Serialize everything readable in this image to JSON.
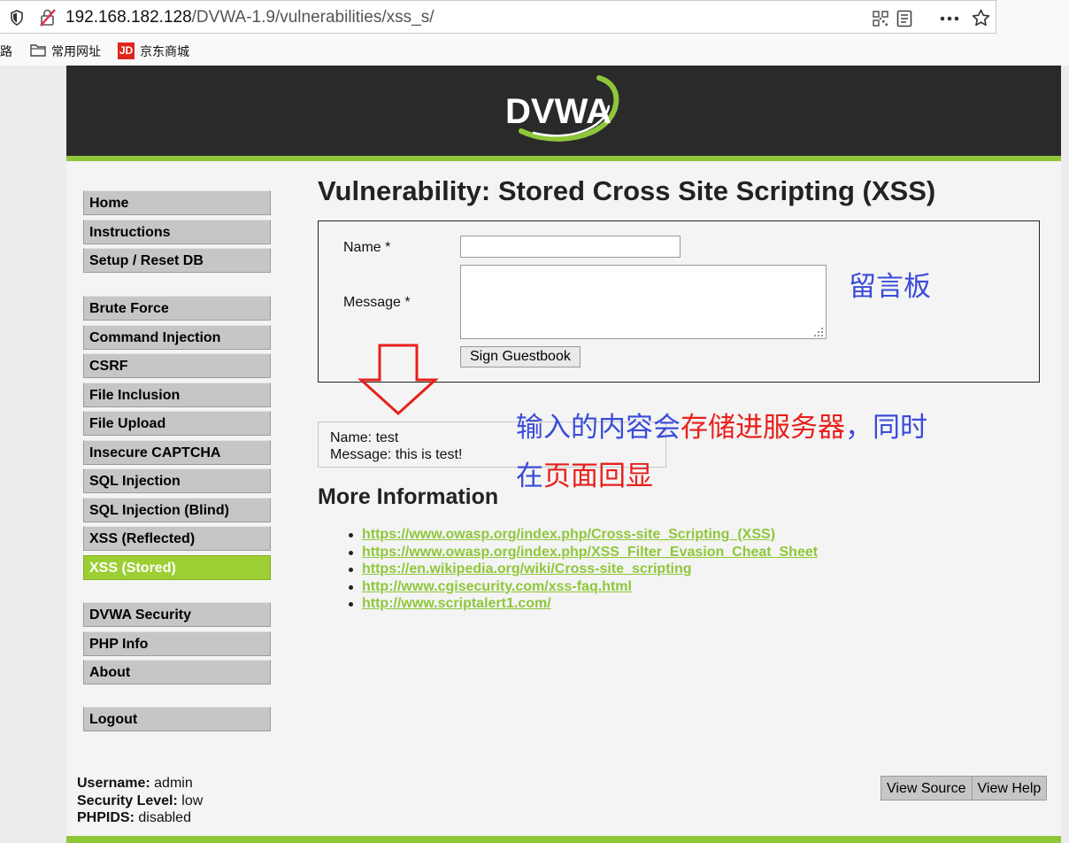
{
  "browser": {
    "url_host": "192.168.182.128",
    "url_path": "/DVWA-1.9/vulnerabilities/xss_s/",
    "bookmarks": [
      {
        "label": "路"
      },
      {
        "label": "常用网址"
      },
      {
        "label": "京东商城"
      }
    ],
    "jd_badge": "JD"
  },
  "header": {
    "logo_text": "DVWA"
  },
  "menu": {
    "group1": [
      "Home",
      "Instructions",
      "Setup / Reset DB"
    ],
    "group2": [
      "Brute Force",
      "Command Injection",
      "CSRF",
      "File Inclusion",
      "File Upload",
      "Insecure CAPTCHA",
      "SQL Injection",
      "SQL Injection (Blind)",
      "XSS (Reflected)",
      "XSS (Stored)"
    ],
    "group3": [
      "DVWA Security",
      "PHP Info",
      "About"
    ],
    "group4": [
      "Logout"
    ]
  },
  "main": {
    "title": "Vulnerability: Stored Cross Site Scripting (XSS)",
    "form": {
      "name_label": "Name *",
      "message_label": "Message *",
      "name_value": "",
      "message_value": "",
      "submit_label": "Sign Guestbook"
    },
    "entry": {
      "name_line": "Name: test",
      "message_line": "Message: this is test!"
    },
    "more_info_title": "More Information",
    "links": [
      "https://www.owasp.org/index.php/Cross-site_Scripting_(XSS)",
      "https://www.owasp.org/index.php/XSS_Filter_Evasion_Cheat_Sheet",
      "https://en.wikipedia.org/wiki/Cross-site_scripting",
      "http://www.cgisecurity.com/xss-faq.html",
      "http://www.scriptalert1.com/"
    ]
  },
  "footer": {
    "username_label": "Username:",
    "username_value": "admin",
    "security_label": "Security Level:",
    "security_value": "low",
    "phpids_label": "PHPIDS:",
    "phpids_value": "disabled",
    "view_source": "View Source",
    "view_help": "View Help"
  },
  "annotations": {
    "board": "留言板",
    "line1_part1": "输入的内容会",
    "line1_part2": "存储进服务器",
    "line1_part3": "，同时",
    "line2_part1": "在",
    "line2_part2": "页面回显"
  },
  "colors": {
    "accent_green": "#8fc73a",
    "header_dark": "#2a2a2a",
    "annotation_blue": "#3a4bd9",
    "annotation_red": "#e8201b"
  }
}
